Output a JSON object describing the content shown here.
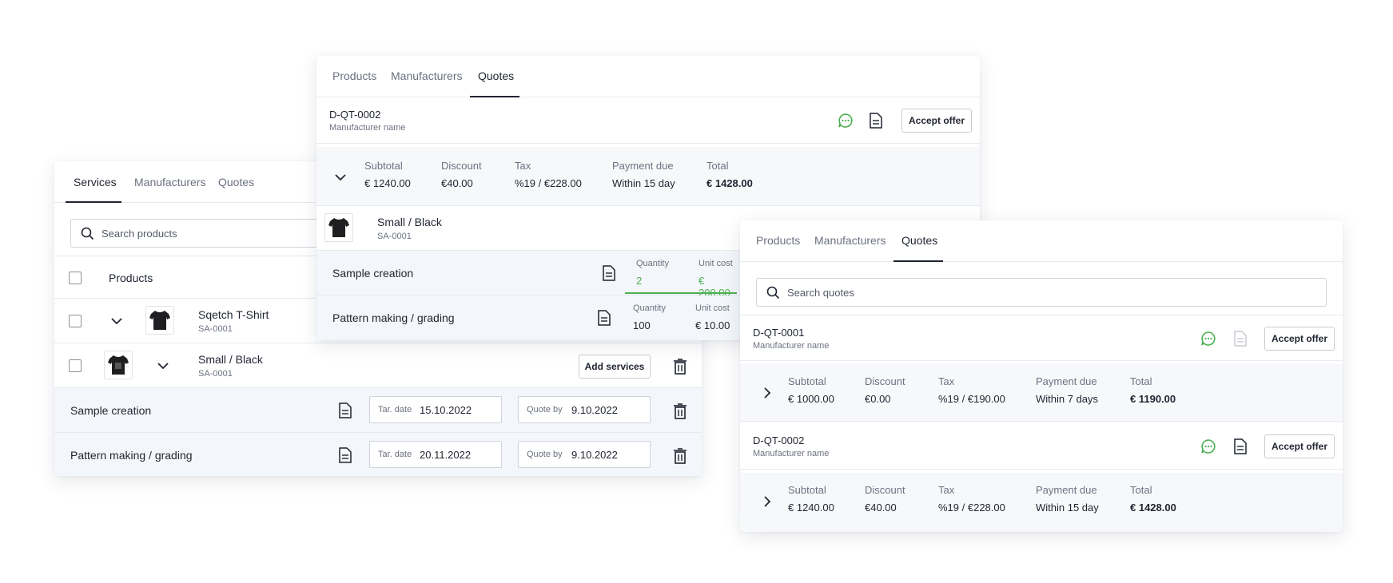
{
  "left_card": {
    "tabs": [
      "Services",
      "Manufacturers",
      "Quotes"
    ],
    "search_placeholder": "Search products",
    "header_label": "Products",
    "product": {
      "name": "Sqetch T-Shirt",
      "sku": "SA-0001"
    },
    "variant": {
      "name": "Small / Black",
      "sku": "SA-0001",
      "add_label": "Add services"
    },
    "services": [
      {
        "name": "Sample creation",
        "tar_label": "Tar. date",
        "tar_date": "15.10.2022",
        "quote_label": "Quote by",
        "quote_date": "9.10.2022"
      },
      {
        "name": "Pattern making / grading",
        "tar_label": "Tar. date",
        "tar_date": "20.11.2022",
        "quote_label": "Quote by",
        "quote_date": "9.10.2022"
      }
    ]
  },
  "middle_card": {
    "tabs": [
      "Products",
      "Manufacturers",
      "Quotes"
    ],
    "quote": {
      "id": "D-QT-0002",
      "manufacturer": "Manufacturer name",
      "accept_label": "Accept offer"
    },
    "summary": {
      "subtotal_label": "Subtotal",
      "subtotal": "€ 1240.00",
      "discount_label": "Discount",
      "discount": "€40.00",
      "tax_label": "Tax",
      "tax": "%19 / €228.00",
      "payment_label": "Payment due",
      "payment": "Within 15 day",
      "total_label": "Total",
      "total": "€ 1428.00"
    },
    "variant": {
      "name": "Small / Black",
      "sku": "SA-0001"
    },
    "services": [
      {
        "name": "Sample creation",
        "qty_label": "Quantity",
        "qty": "2",
        "cost_label": "Unit cost",
        "cost": "€ 200.00"
      },
      {
        "name": "Pattern making / grading",
        "qty_label": "Quantity",
        "qty": "100",
        "cost_label": "Unit cost",
        "cost": "€ 10.00"
      }
    ]
  },
  "right_card": {
    "tabs": [
      "Products",
      "Manufacturers",
      "Quotes"
    ],
    "search_placeholder": "Search quotes",
    "quotes": [
      {
        "id": "D-QT-0001",
        "manufacturer": "Manufacturer name",
        "accept_label": "Accept offer",
        "subtotal_label": "Subtotal",
        "subtotal": "€ 1000.00",
        "discount_label": "Discount",
        "discount": "€0.00",
        "tax_label": "Tax",
        "tax": "%19 / €190.00",
        "payment_label": "Payment due",
        "payment": "Within 7 days",
        "total_label": "Total",
        "total": "€ 1190.00"
      },
      {
        "id": "D-QT-0002",
        "manufacturer": "Manufacturer name",
        "accept_label": "Accept offer",
        "subtotal_label": "Subtotal",
        "subtotal": "€ 1240.00",
        "discount_label": "Discount",
        "discount": "€40.00",
        "tax_label": "Tax",
        "tax": "%19 / €228.00",
        "payment_label": "Payment due",
        "payment": "Within 15 day",
        "total_label": "Total",
        "total": "€ 1428.00"
      }
    ]
  },
  "colors": {
    "accent_green": "#4caf50",
    "text": "#1f2430",
    "muted": "#6b7280",
    "row_blue": "#f3f6fa"
  },
  "icons": [
    "search-icon",
    "chevron-down-icon",
    "chevron-right-icon",
    "document-icon",
    "chat-icon",
    "trash-icon",
    "tshirt-icon"
  ]
}
